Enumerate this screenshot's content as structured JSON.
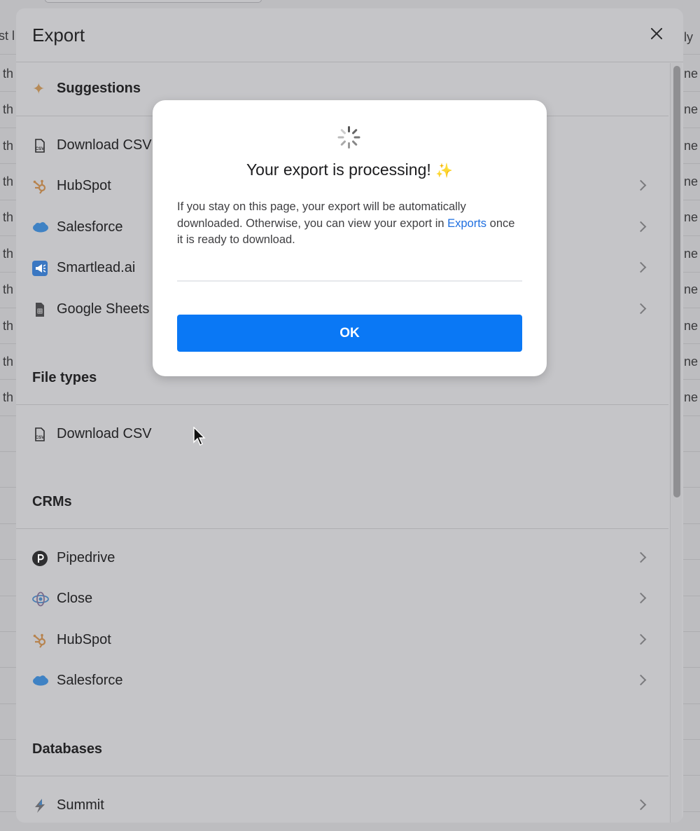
{
  "background": {
    "left_column_fragments": [
      "st l",
      "th",
      "th",
      "th",
      "th",
      "th",
      "th",
      "th",
      "th",
      "th",
      "th"
    ],
    "right_column_fragments": [
      "ly",
      "ne",
      "ne",
      "ne",
      "ne",
      "ne",
      "ne",
      "ne",
      "ne",
      "ne",
      "ne"
    ]
  },
  "panel": {
    "title": "Export",
    "sections": {
      "suggestions": {
        "title": "Suggestions",
        "items": [
          {
            "label": "Download CSV",
            "icon": "csv-file-icon"
          },
          {
            "label": "HubSpot",
            "icon": "hubspot-icon"
          },
          {
            "label": "Salesforce",
            "icon": "salesforce-icon"
          },
          {
            "label": "Smartlead.ai",
            "icon": "smartlead-icon"
          },
          {
            "label": "Google Sheets",
            "icon": "google-sheets-icon"
          }
        ]
      },
      "file_types": {
        "title": "File types",
        "items": [
          {
            "label": "Download CSV",
            "icon": "csv-file-icon"
          }
        ]
      },
      "crms": {
        "title": "CRMs",
        "items": [
          {
            "label": "Pipedrive",
            "icon": "pipedrive-icon"
          },
          {
            "label": "Close",
            "icon": "close-crm-icon"
          },
          {
            "label": "HubSpot",
            "icon": "hubspot-icon"
          },
          {
            "label": "Salesforce",
            "icon": "salesforce-icon"
          }
        ]
      },
      "databases": {
        "title": "Databases",
        "items": [
          {
            "label": "Summit",
            "icon": "summit-icon"
          }
        ]
      }
    }
  },
  "modal": {
    "title": "Your export is processing!",
    "title_emoji": "✨",
    "body_before_link": "If you stay on this page, your export will be automatically downloaded. Otherwise, you can view your export in ",
    "link_text": "Exports",
    "body_after_link": " once it is ready to download.",
    "ok_label": "OK"
  },
  "colors": {
    "primary_button": "#0a78f5",
    "link": "#1f6fe0",
    "overlay_dim": "#c5c5c8"
  }
}
